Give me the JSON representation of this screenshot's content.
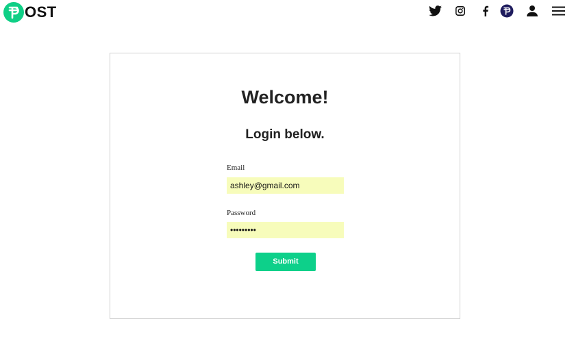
{
  "header": {
    "logo_text": "OST",
    "brand_color": "#0fcf86",
    "icons": [
      "twitter-icon",
      "instagram-icon",
      "facebook-icon",
      "post-coin-icon",
      "user-icon",
      "menu-icon"
    ]
  },
  "login": {
    "title": "Welcome!",
    "subtitle": "Login below.",
    "email_label": "Email",
    "email_value": "ashley@gmail.com",
    "password_label": "Password",
    "password_value": "•••••••••",
    "submit_label": "Submit",
    "input_fill_color": "#f7fcbb",
    "submit_color": "#0dd08a"
  }
}
